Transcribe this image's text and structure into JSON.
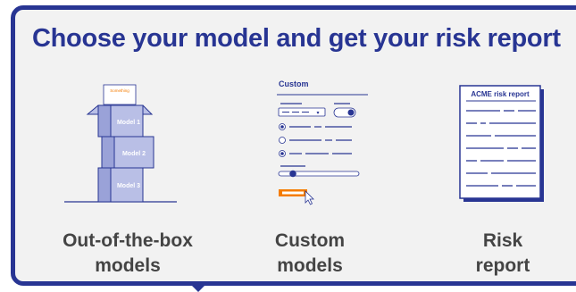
{
  "title": "Choose your model and get your risk report",
  "boxes": {
    "top_label": "Something",
    "labels": [
      "Model 1",
      "Model 2",
      "Model 3"
    ]
  },
  "custom_form": {
    "header": "Custom"
  },
  "report": {
    "header": "ACME risk report"
  },
  "captions": [
    {
      "line1": "Out-of-the-box",
      "line2": "models"
    },
    {
      "line1": "Custom",
      "line2": "models"
    },
    {
      "line1": "Risk",
      "line2": "report"
    }
  ],
  "colors": {
    "brand": "#283593",
    "box_fill": "#b9bfe6",
    "accent": "#f57c00",
    "caption_text": "#444444",
    "panel_bg": "#f2f2f2"
  }
}
